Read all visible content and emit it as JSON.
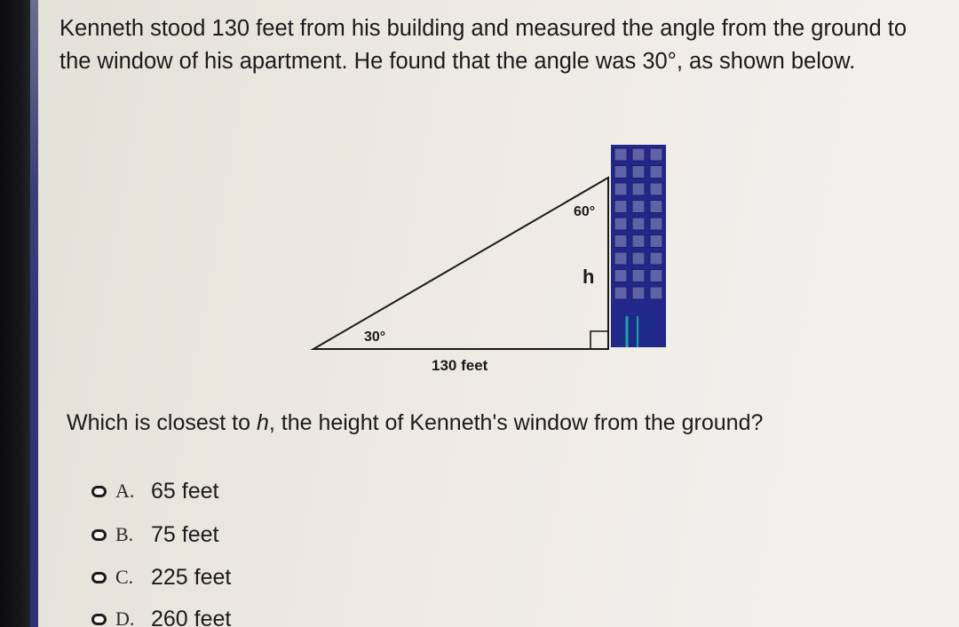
{
  "question": {
    "text": "Kenneth stood 130 feet from his building and measured the angle from the ground to the window of his apartment. He found that the angle was 30°, as shown below."
  },
  "diagram": {
    "angle_bottom": "30°",
    "angle_top": "60°",
    "height_label": "h",
    "base_label": "130 feet"
  },
  "prompt": {
    "before": "Which is closest to ",
    "variable": "h",
    "after": ", the height of Kenneth's window from the ground?"
  },
  "choices": [
    {
      "letter": "A.",
      "text": "65 feet"
    },
    {
      "letter": "B.",
      "text": "75 feet"
    },
    {
      "letter": "C.",
      "text": "225 feet"
    },
    {
      "letter": "D.",
      "text": "260 feet"
    }
  ],
  "colors": {
    "building": "#24278a",
    "door": "#1fa3a8",
    "window_fill": "#5f62a5"
  }
}
